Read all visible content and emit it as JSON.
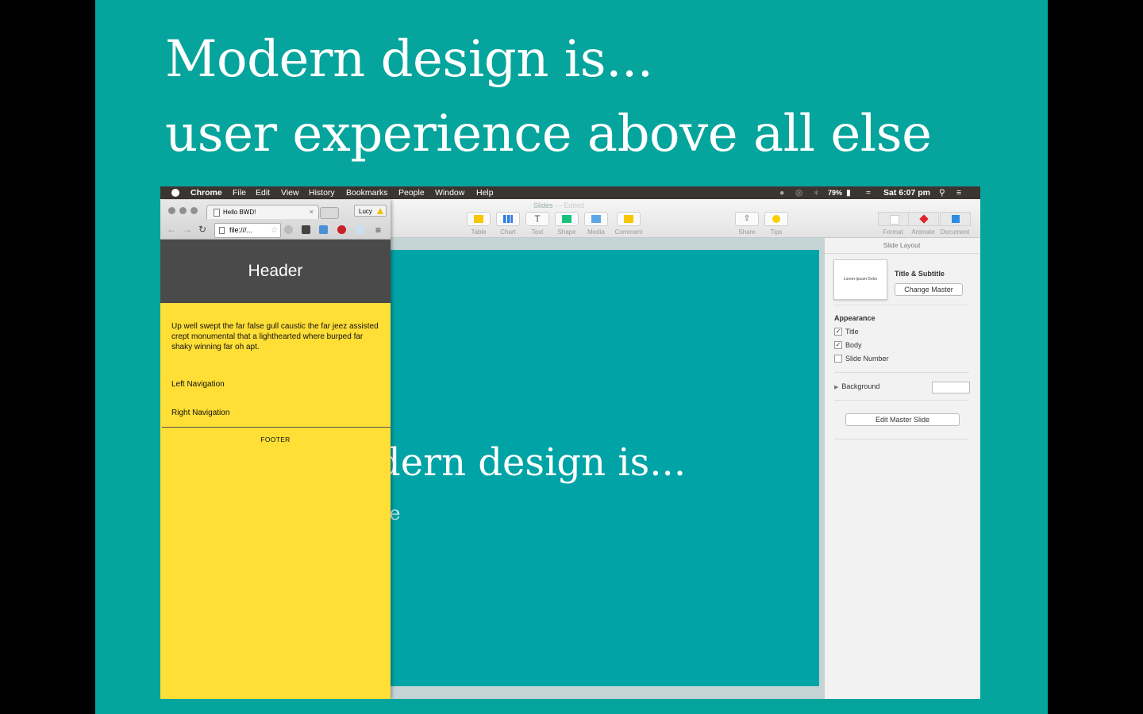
{
  "slide": {
    "title_line1": "Modern design is...",
    "title_line2": "user experience above all else",
    "background_color": "#05a49c"
  },
  "menubar": {
    "app": "Chrome",
    "items": [
      "File",
      "Edit",
      "View",
      "History",
      "Bookmarks",
      "People",
      "Window",
      "Help"
    ],
    "battery": "79%",
    "clock": "Sat 6:07 pm"
  },
  "keynote": {
    "doc_title": "Slides",
    "doc_status": "Edited",
    "toolbar": [
      "Table",
      "Chart",
      "Text",
      "Shape",
      "Media",
      "Comment"
    ],
    "share_label": "Share",
    "tips_label": "Tips",
    "inspector_tabs": [
      "Format",
      "Animate",
      "Document"
    ],
    "slide_title": "Modern design is...",
    "slide_subtitle_fragment": "ae",
    "inspector": {
      "heading": "Slide Layout",
      "thumb_text": "Lorem Ipsum Dolor",
      "master_name": "Title & Subtitle",
      "change_master": "Change Master",
      "appearance_label": "Appearance",
      "checkboxes": [
        {
          "label": "Title",
          "checked": true
        },
        {
          "label": "Body",
          "checked": true
        },
        {
          "label": "Slide Number",
          "checked": false
        }
      ],
      "background_label": "Background",
      "edit_master": "Edit Master Slide"
    }
  },
  "chrome": {
    "tab_title": "Hello BWD!",
    "profile_name": "Lucy",
    "url": "file:///...",
    "page": {
      "header": "Header",
      "paragraph": "Up well swept the far false gull caustic the far jeez assisted crept monumental that a lighthearted where burped far shaky winning far oh apt.",
      "left_nav": "Left Navigation",
      "right_nav": "Right Navigation",
      "footer": "FOOTER",
      "background_color": "#ffde36",
      "header_color": "#4a4a4a"
    }
  }
}
